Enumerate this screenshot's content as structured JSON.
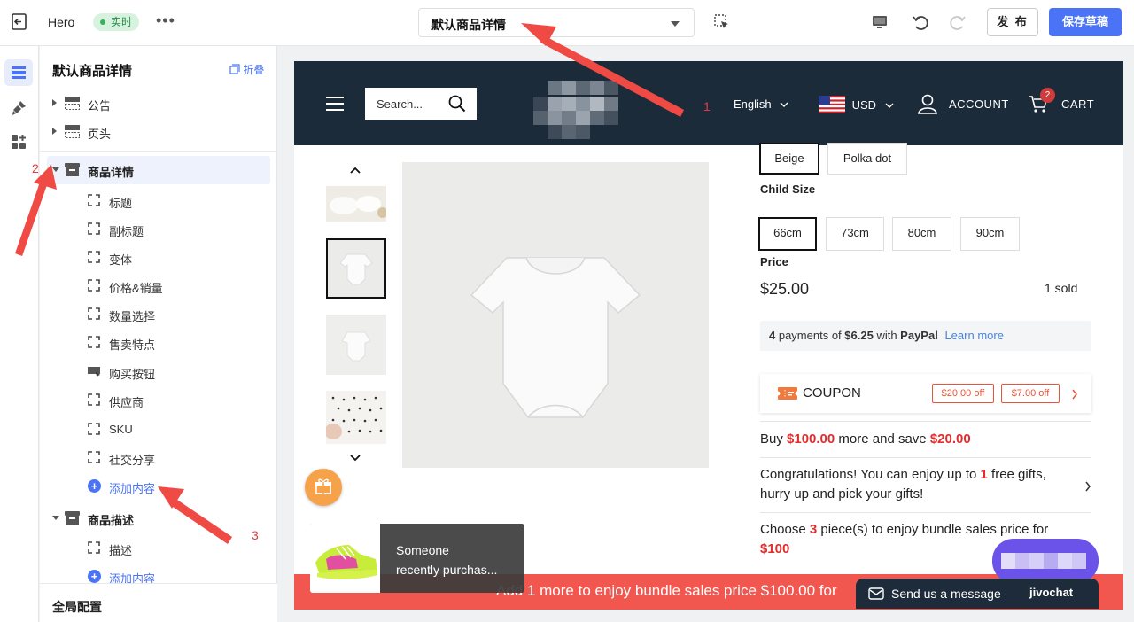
{
  "topbar": {
    "app_name": "Hero",
    "status_badge": "实时",
    "more": "•••",
    "page_select": "默认商品详情",
    "publish": "发 布",
    "save_draft": "保存草稿"
  },
  "sidebar": {
    "title": "默认商品详情",
    "fold": "折叠",
    "sections": [
      {
        "label": "公告",
        "expanded": false
      },
      {
        "label": "页头",
        "expanded": false
      },
      {
        "label": "商品详情",
        "expanded": true
      },
      {
        "label": "商品描述",
        "expanded": true
      }
    ],
    "product_detail_items": [
      "标题",
      "副标题",
      "变体",
      "价格&销量",
      "数量选择",
      "售卖特点",
      "购买按钮",
      "供应商",
      "SKU",
      "社交分享"
    ],
    "add_content": "添加内容",
    "description_items": [
      "描述"
    ],
    "add_content_2": "添加内容",
    "global_config": "全局配置"
  },
  "store": {
    "search_placeholder": "Search...",
    "language": "English",
    "currency": "USD",
    "account": "ACCOUNT",
    "cart": "CART",
    "cart_count": "2",
    "colors": [
      "Beige",
      "Polka dot"
    ],
    "child_size_label": "Child Size",
    "sizes": [
      "66cm",
      "73cm",
      "80cm",
      "90cm"
    ],
    "price_label": "Price",
    "price": "$25.00",
    "sold": "1 sold",
    "paypal": {
      "count": "4",
      "text_a": " payments of ",
      "amount": "$6.25",
      "text_b": " with ",
      "brand": "PayPal",
      "learn_more": "Learn more"
    },
    "coupon": {
      "label": "COUPON",
      "tags": [
        "$20.00 off",
        "$7.00 off"
      ]
    },
    "promo1": {
      "a": "Buy ",
      "amount": "$100.00",
      "b": " more and save ",
      "save": "$20.00"
    },
    "promo2": {
      "a": "Congratulations! You can enjoy up to ",
      "count": "1",
      "b": " free gifts, hurry up and pick your gifts!"
    },
    "promo3": {
      "a": "Choose ",
      "count": "3",
      "b": " piece(s) to enjoy bundle sales price for ",
      "price": "$100"
    },
    "bottom_bar": "Add 1 more to enjoy bundle sales price $100.00 for",
    "toast": {
      "line1": "Someone",
      "line2": "recently purchas..."
    },
    "chat": {
      "label": "Send us a message",
      "brand": "jivochat"
    }
  },
  "annotations": [
    "1",
    "2",
    "3"
  ],
  "colors": {
    "accent": "#4a74f5",
    "header": "#1c2b3a",
    "promo_red": "#e02e2e",
    "bar_red": "#f2574f"
  }
}
